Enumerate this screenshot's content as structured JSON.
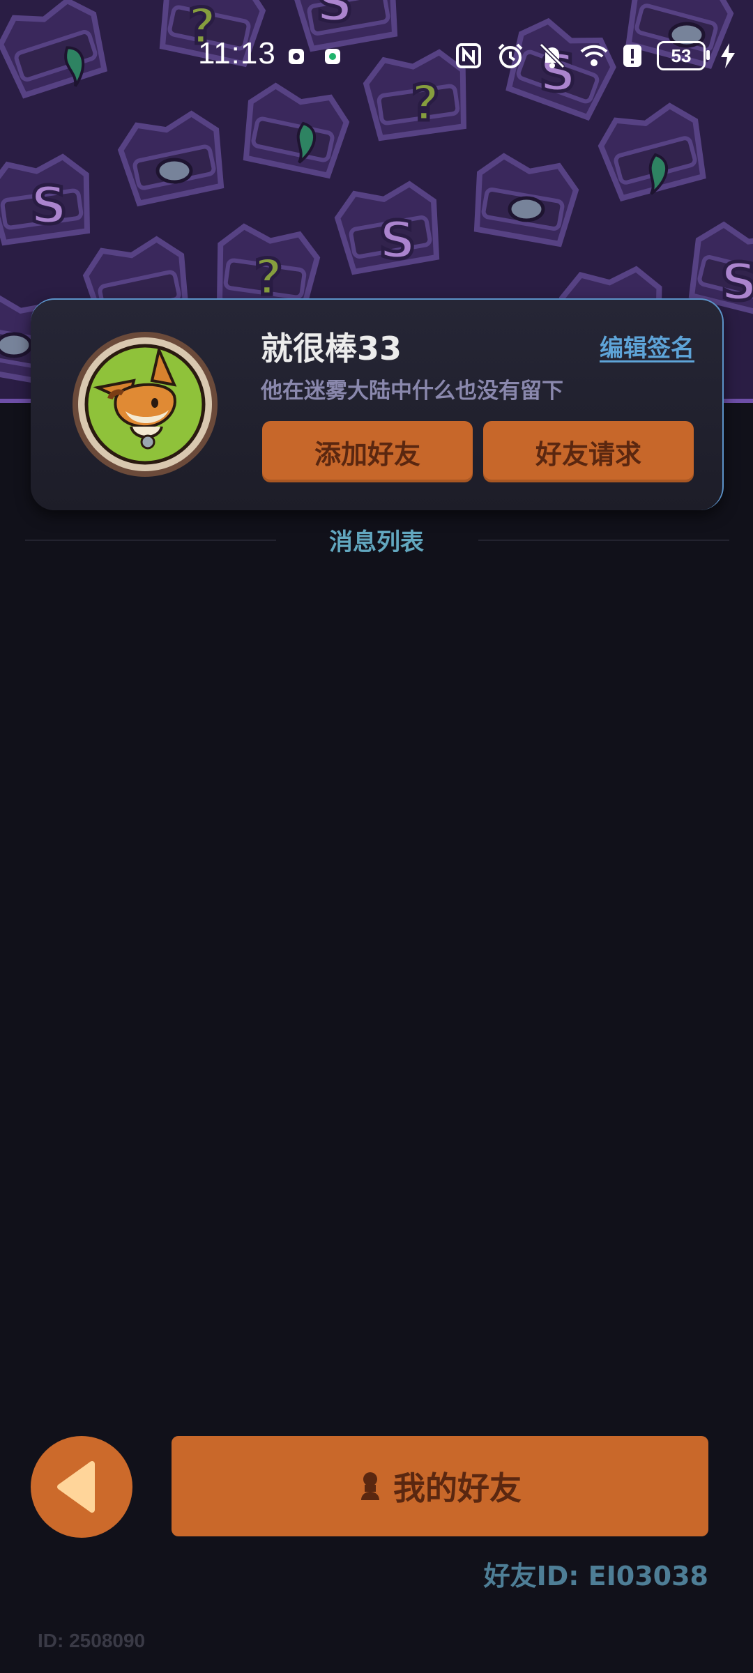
{
  "status_bar": {
    "time": "11:13",
    "battery_level": "53",
    "icons": [
      "notification-icon",
      "notification-icon",
      "nfc-icon",
      "alarm-icon",
      "bell-off-icon",
      "wifi-icon",
      "alert-icon",
      "battery-icon",
      "charging-icon"
    ]
  },
  "profile": {
    "username": "就很棒33",
    "edit_signature_label": "编辑签名",
    "signature": "他在迷雾大陆中什么也没有留下",
    "add_friend_label": "添加好友",
    "friend_requests_label": "好友请求"
  },
  "messages": {
    "section_title": "消息列表",
    "items": []
  },
  "bottom": {
    "my_friends_label": "我的好友",
    "friend_id_text": "好友ID: EI03038",
    "user_id_text": "ID: 2508090"
  },
  "colors": {
    "background": "#11111a",
    "accent_orange": "#c9682a",
    "header_purple": "#2a1d44",
    "link_blue": "#5ea4d8",
    "teal_text": "#62a7bf"
  }
}
